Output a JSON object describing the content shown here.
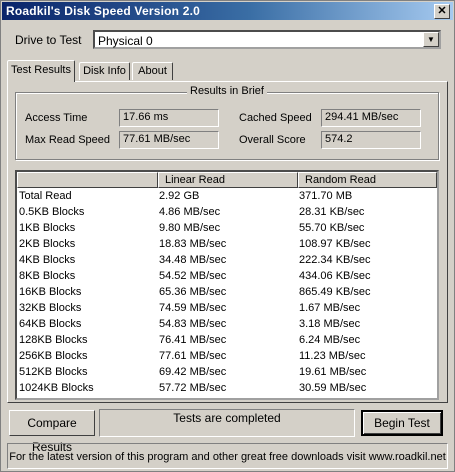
{
  "window": {
    "title": "Roadkil's Disk Speed Version 2.0",
    "close_glyph": "✕"
  },
  "drive": {
    "label": "Drive to Test",
    "selected": "Physical 0"
  },
  "tabs": [
    {
      "label": "Test Results"
    },
    {
      "label": "Disk Info"
    },
    {
      "label": "About"
    }
  ],
  "brief": {
    "title": "Results in Brief",
    "access_time_label": "Access Time",
    "access_time": "17.66 ms",
    "max_read_label": "Max Read Speed",
    "max_read": "77.61 MB/sec",
    "cached_label": "Cached Speed",
    "cached": "294.41 MB/sec",
    "score_label": "Overall Score",
    "score": "574.2"
  },
  "table": {
    "columns": [
      "",
      "Linear Read",
      "Random Read"
    ],
    "rows": [
      [
        "Total Read",
        "2.92 GB",
        "371.70 MB"
      ],
      [
        "0.5KB Blocks",
        "4.86 MB/sec",
        "28.31 KB/sec"
      ],
      [
        "1KB Blocks",
        "9.80 MB/sec",
        "55.70 KB/sec"
      ],
      [
        "2KB Blocks",
        "18.83 MB/sec",
        "108.97 KB/sec"
      ],
      [
        "4KB Blocks",
        "34.48 MB/sec",
        "222.34 KB/sec"
      ],
      [
        "8KB Blocks",
        "54.52 MB/sec",
        "434.06 KB/sec"
      ],
      [
        "16KB Blocks",
        "65.36 MB/sec",
        "865.49 KB/sec"
      ],
      [
        "32KB Blocks",
        "74.59 MB/sec",
        "1.67 MB/sec"
      ],
      [
        "64KB Blocks",
        "54.83 MB/sec",
        "3.18 MB/sec"
      ],
      [
        "128KB Blocks",
        "76.41 MB/sec",
        "6.24 MB/sec"
      ],
      [
        "256KB Blocks",
        "77.61 MB/sec",
        "11.23 MB/sec"
      ],
      [
        "512KB Blocks",
        "69.42 MB/sec",
        "19.61 MB/sec"
      ],
      [
        "1024KB Blocks",
        "57.72 MB/sec",
        "30.59 MB/sec"
      ]
    ]
  },
  "buttons": {
    "compare": "Compare Results",
    "begin": "Begin Test"
  },
  "status": "Tests are completed",
  "footer": "For the latest version of this program and other great free downloads visit www.roadkil.net"
}
